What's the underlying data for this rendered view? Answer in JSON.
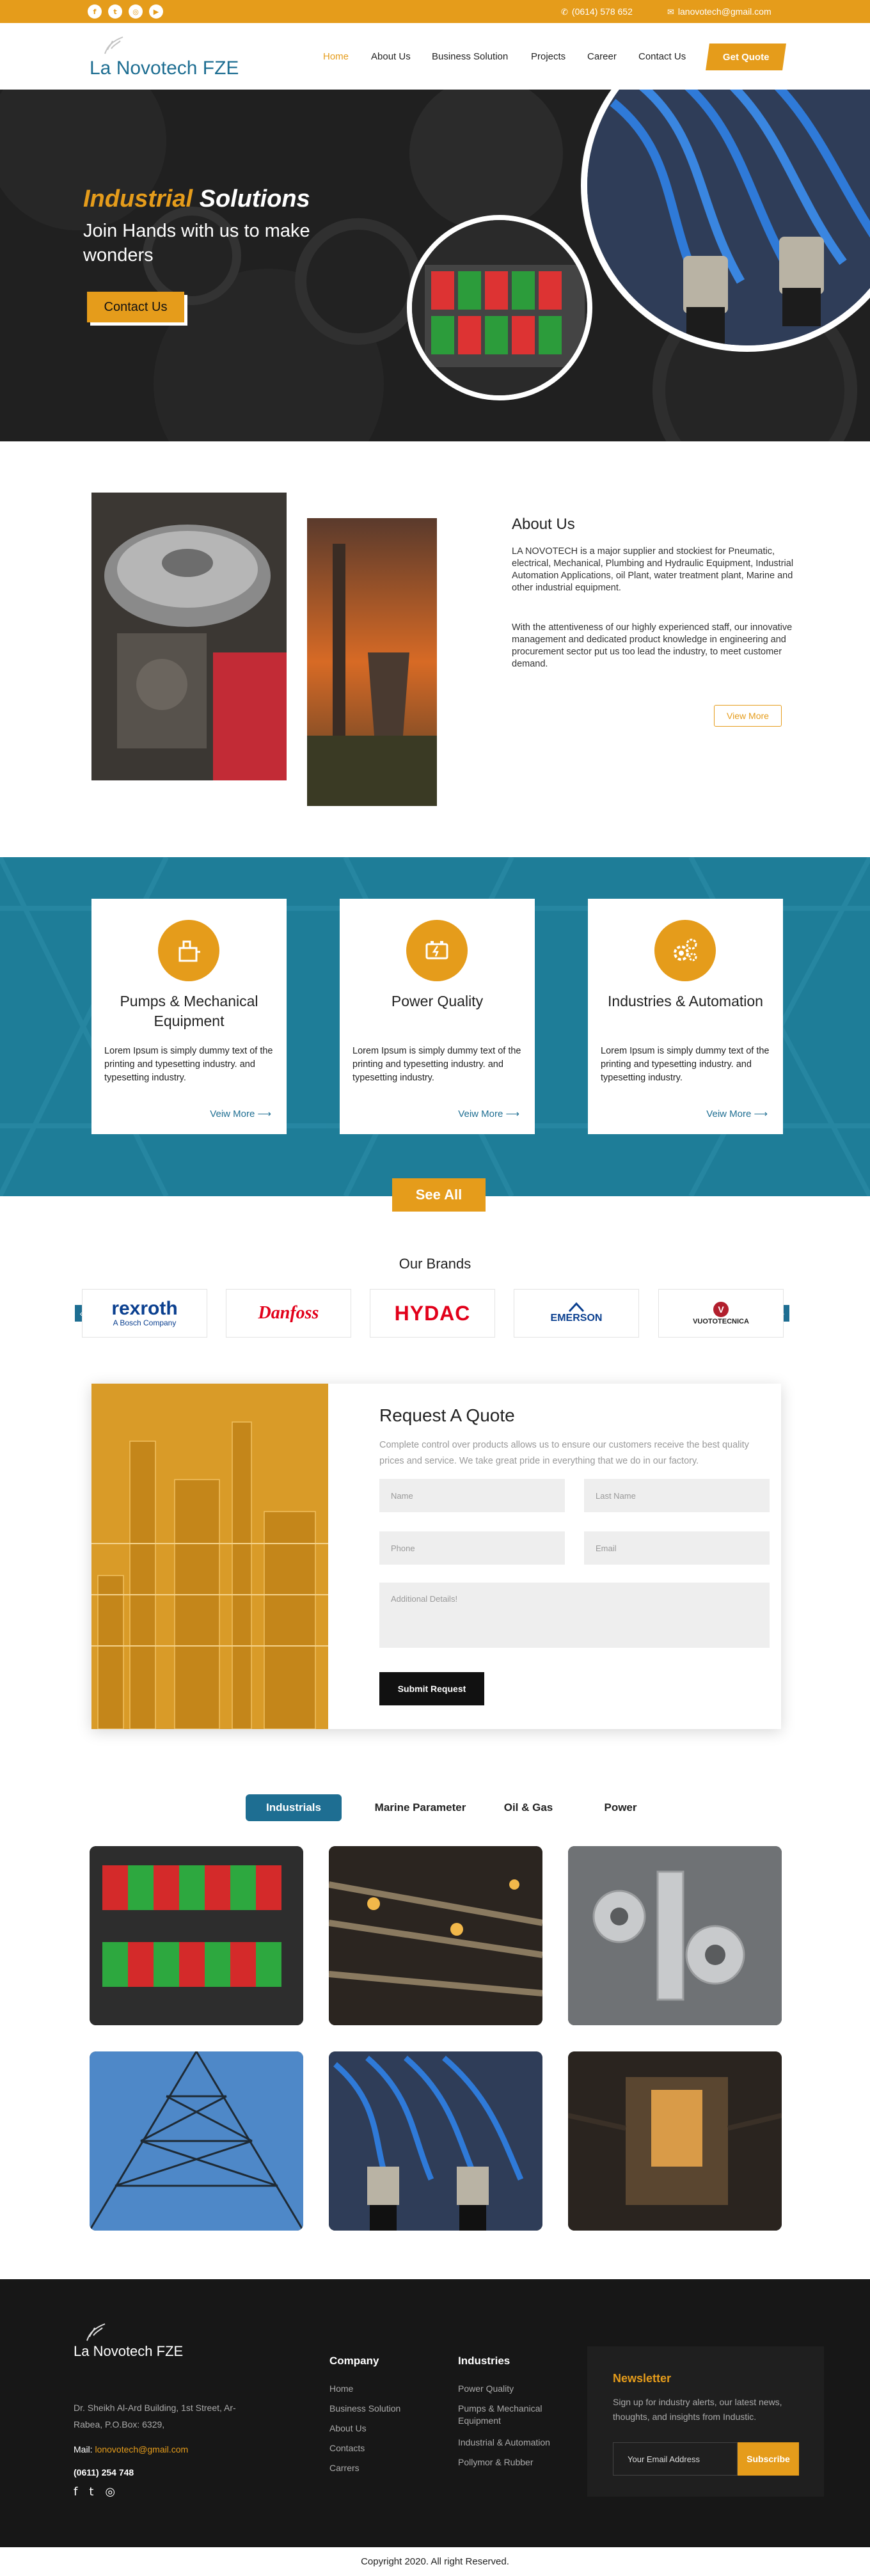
{
  "topbar": {
    "social": [
      "f",
      "t",
      "i",
      "yt"
    ],
    "phone": "(0614) 578 652",
    "email": "lanovotech@gmail.com"
  },
  "header": {
    "brand": "La Novotech FZE",
    "nav": [
      "Home",
      "About Us",
      "Business Solution",
      "Projects",
      "Career",
      "Contact Us"
    ],
    "active_nav": "Home",
    "quote_button": "Get Quote"
  },
  "hero": {
    "title_a": "Industrial",
    "title_b": "Solutions",
    "subtitle": "Join Hands with us to make wonders",
    "button": "Contact Us"
  },
  "about": {
    "title": "About Us",
    "p1": "LA NOVOTECH is a major supplier and stockiest for Pneumatic, electrical, Mechanical, Plumbing and Hydraulic Equipment, Industrial Automation Applications, oil Plant, water treatment plant, Marine and other industrial equipment.",
    "p2": "With the attentiveness of our highly experienced staff, our innovative management and dedicated product knowledge in engineering and procurement sector put us too lead the industry, to meet customer demand.",
    "button": "View More"
  },
  "services": {
    "cards": [
      {
        "title": "Pumps & Mechanical Equipment",
        "text": "Lorem Ipsum is simply dummy text of the printing and typesetting industry. and typesetting industry.",
        "more": "Veiw More ⟶",
        "icon": "pump-icon"
      },
      {
        "title": "Power Quality",
        "text": "Lorem Ipsum is simply dummy text of the printing and typesetting industry. and typesetting industry.",
        "more": "Veiw More ⟶",
        "icon": "battery-icon"
      },
      {
        "title": "Industries & Automation",
        "text": "Lorem Ipsum is simply dummy text of the printing and typesetting industry. and typesetting industry.",
        "more": "Veiw More ⟶",
        "icon": "gears-icon"
      }
    ],
    "see_all": "See All"
  },
  "brands": {
    "title": "Our Brands",
    "items": [
      {
        "name": "rexroth",
        "sub": "A Bosch Company"
      },
      {
        "name": "Danfoss",
        "sub": ""
      },
      {
        "name": "HYDAC",
        "sub": ""
      },
      {
        "name": "EMERSON",
        "sub": ""
      },
      {
        "name": "VUOTOTECNICA",
        "sub": ""
      }
    ]
  },
  "quote": {
    "title": "Request A Quote",
    "description": "Complete control over products allows us to ensure our customers receive the best quality prices and service. We take great pride in everything that we do in our factory.",
    "name_ph": "Name",
    "last_ph": "Last Name",
    "phone_ph": "Phone",
    "email_ph": "Email",
    "details_ph": "Additional Details!",
    "submit": "Submit Request"
  },
  "gallery": {
    "tabs": [
      "Industrials",
      "Marine Parameter",
      "Oil & Gas",
      "Power"
    ],
    "active_tab": "Industrials"
  },
  "footer": {
    "brand": "La Novotech FZE",
    "address": "Dr. Sheikh Al-Ard Building, 1st Street, Ar-Rabea, P.O.Box: 6329,",
    "mail_label": "Mail:",
    "mail": "lonovotech@gmail.com",
    "phone": "(0611) 254 748",
    "company_title": "Company",
    "company_links": [
      "Home",
      "Business Solution",
      "About Us",
      "Contacts",
      "Carrers"
    ],
    "industries_title": "Industries",
    "industries_links": [
      "Power Quality",
      "Pumps & Mechanical Equipment",
      "Industrial & Automation",
      "Pollymor & Rubber"
    ],
    "newsletter_title": "Newsletter",
    "newsletter_desc": "Sign up for industry alerts, our latest news, thoughts, and insights from Industic.",
    "newsletter_ph": "Your Email Address",
    "newsletter_btn": "Subscribe",
    "copyright": "Copyright 2020. All right Reserved."
  },
  "colors": {
    "accent": "#e59c1b",
    "primary": "#1e6e92",
    "footer_bg": "#171717"
  }
}
